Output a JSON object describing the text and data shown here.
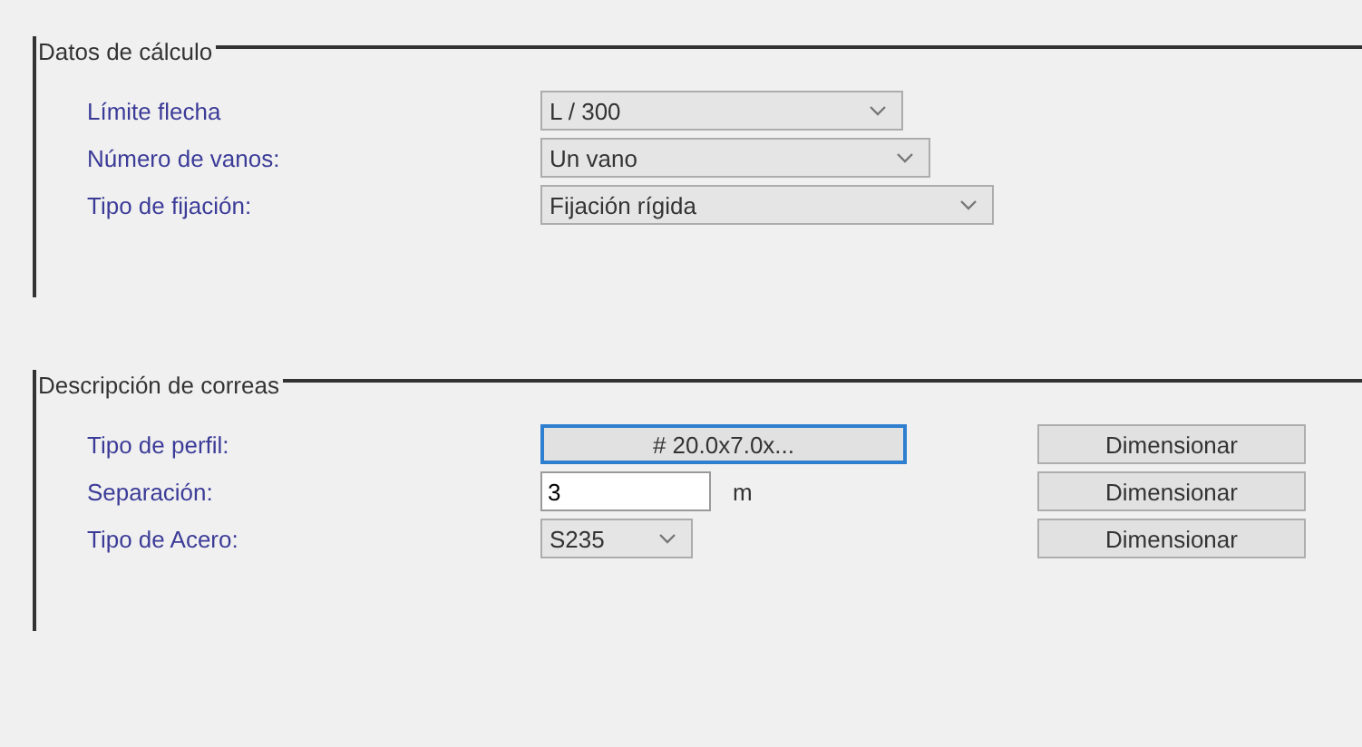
{
  "groups": [
    {
      "title": "Datos de cálculo",
      "rows": [
        {
          "label": "Límite flecha",
          "kind": "select",
          "value": "L / 300"
        },
        {
          "label": "Número de vanos:",
          "kind": "select",
          "value": "Un vano"
        },
        {
          "label": "Tipo de fijación:",
          "kind": "select",
          "value": "Fijación rígida"
        }
      ]
    },
    {
      "title": "Descripción de correas",
      "rows": [
        {
          "label": "Tipo de perfil:",
          "kind": "button",
          "value": "# 20.0x7.0x...",
          "focused": true,
          "action": "Dimensionar"
        },
        {
          "label": "Separación:",
          "kind": "input",
          "value": "3",
          "unit": "m",
          "action": "Dimensionar"
        },
        {
          "label": "Tipo de Acero:",
          "kind": "select",
          "value": "S235",
          "action": "Dimensionar"
        }
      ]
    }
  ]
}
